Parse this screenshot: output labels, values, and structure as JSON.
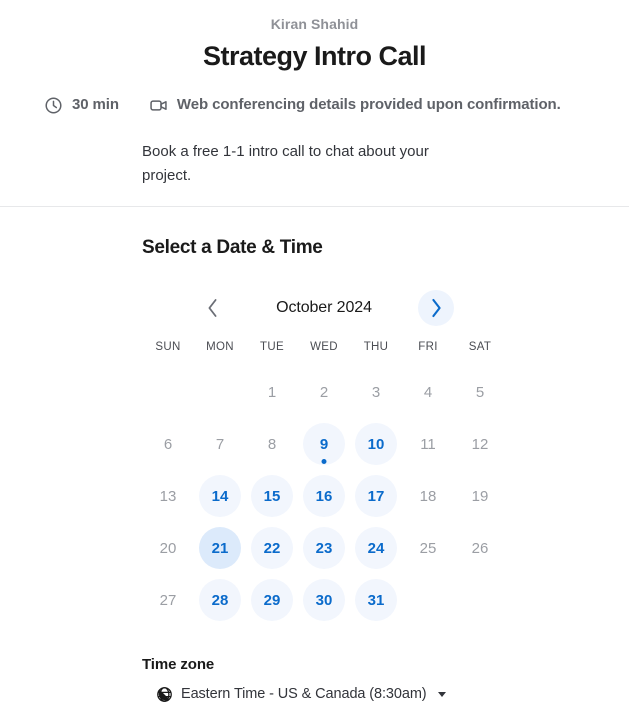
{
  "header": {
    "organizer": "Kiran Shahid",
    "event_title": "Strategy Intro Call"
  },
  "meta": {
    "duration_icon": "clock-icon",
    "duration": "30 min",
    "location_icon": "video-camera-icon",
    "location": "Web conferencing details provided upon confirmation."
  },
  "description": "Book a free 1-1 intro call to chat about your project.",
  "booking": {
    "section_title": "Select a Date & Time",
    "calendar": {
      "month_label": "October 2024",
      "prev_icon": "chevron-left-icon",
      "next_icon": "chevron-right-icon",
      "prev_enabled": false,
      "next_enabled": true,
      "weekdays": [
        "SUN",
        "MON",
        "TUE",
        "WED",
        "THU",
        "FRI",
        "SAT"
      ],
      "leading_blanks": 2,
      "days": [
        {
          "label": "1",
          "state": "disabled"
        },
        {
          "label": "2",
          "state": "disabled"
        },
        {
          "label": "3",
          "state": "disabled"
        },
        {
          "label": "4",
          "state": "disabled"
        },
        {
          "label": "5",
          "state": "disabled"
        },
        {
          "label": "6",
          "state": "disabled"
        },
        {
          "label": "7",
          "state": "disabled"
        },
        {
          "label": "8",
          "state": "disabled"
        },
        {
          "label": "9",
          "state": "available",
          "today": true
        },
        {
          "label": "10",
          "state": "available"
        },
        {
          "label": "11",
          "state": "disabled"
        },
        {
          "label": "12",
          "state": "disabled"
        },
        {
          "label": "13",
          "state": "disabled"
        },
        {
          "label": "14",
          "state": "available"
        },
        {
          "label": "15",
          "state": "available"
        },
        {
          "label": "16",
          "state": "available"
        },
        {
          "label": "17",
          "state": "available"
        },
        {
          "label": "18",
          "state": "disabled"
        },
        {
          "label": "19",
          "state": "disabled"
        },
        {
          "label": "20",
          "state": "disabled"
        },
        {
          "label": "21",
          "state": "available",
          "hover": true
        },
        {
          "label": "22",
          "state": "available"
        },
        {
          "label": "23",
          "state": "available"
        },
        {
          "label": "24",
          "state": "available"
        },
        {
          "label": "25",
          "state": "disabled"
        },
        {
          "label": "26",
          "state": "disabled"
        },
        {
          "label": "27",
          "state": "disabled"
        },
        {
          "label": "28",
          "state": "available"
        },
        {
          "label": "29",
          "state": "available"
        },
        {
          "label": "30",
          "state": "available"
        },
        {
          "label": "31",
          "state": "available"
        }
      ]
    },
    "timezone": {
      "title": "Time zone",
      "icon": "globe-icon",
      "value": "Eastern Time - US & Canada (8:30am)",
      "caret_icon": "caret-down-icon"
    }
  },
  "colors": {
    "accent_blue": "#0b6bcb",
    "available_bg": "#f2f6fd",
    "hover_bg": "#dceafb",
    "text_primary": "#1a1a1a",
    "text_muted": "#9b9ea4"
  }
}
